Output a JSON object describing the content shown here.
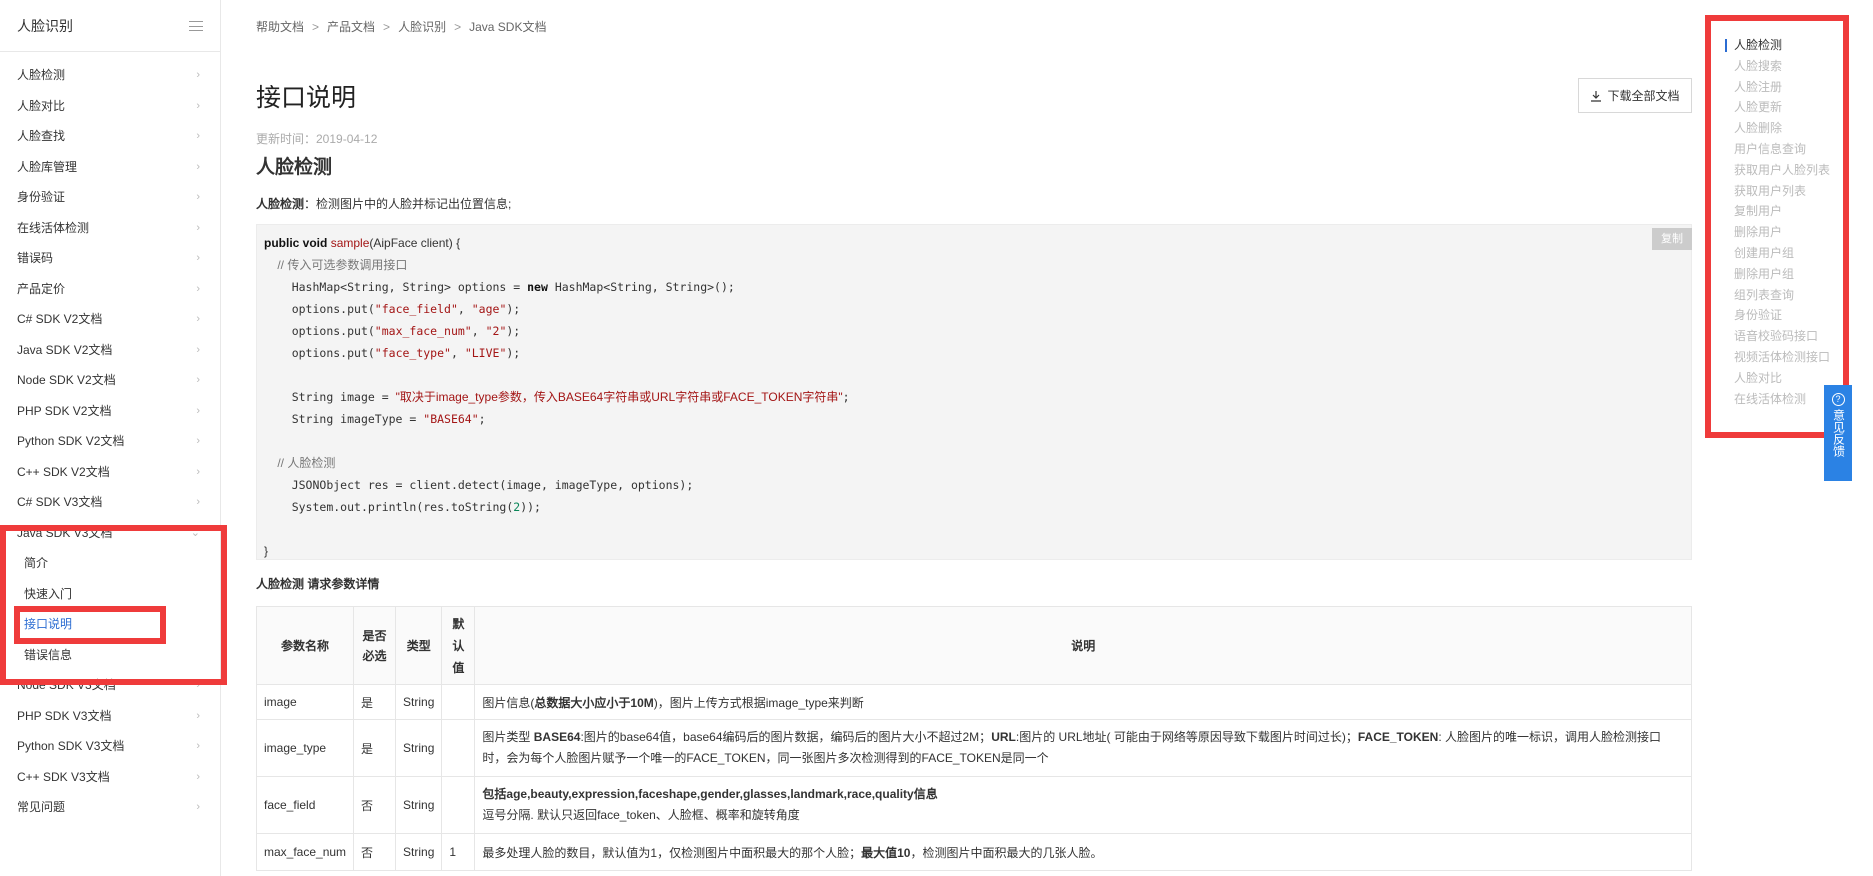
{
  "sidebar": {
    "title": "人脸识别",
    "items": [
      {
        "label": "人脸检测"
      },
      {
        "label": "人脸对比"
      },
      {
        "label": "人脸查找"
      },
      {
        "label": "人脸库管理"
      },
      {
        "label": "身份验证"
      },
      {
        "label": "在线活体检测"
      },
      {
        "label": "错误码"
      },
      {
        "label": "产品定价"
      },
      {
        "label": "C# SDK V2文档"
      },
      {
        "label": "Java SDK V2文档"
      },
      {
        "label": "Node SDK V2文档"
      },
      {
        "label": "PHP SDK V2文档"
      },
      {
        "label": "Python SDK V2文档"
      },
      {
        "label": "C++ SDK V2文档"
      },
      {
        "label": "C# SDK V3文档"
      },
      {
        "label": "Java SDK V3文档"
      }
    ],
    "sub_items": [
      {
        "label": "简介"
      },
      {
        "label": "快速入门"
      },
      {
        "label": "接口说明"
      },
      {
        "label": "错误信息"
      }
    ],
    "items_after": [
      {
        "label": "Node SDK V3文档"
      },
      {
        "label": "PHP SDK V3文档"
      },
      {
        "label": "Python SDK V3文档"
      },
      {
        "label": "C++ SDK V3文档"
      },
      {
        "label": "常见问题"
      }
    ]
  },
  "breadcrumb": [
    "帮助文档",
    "产品文档",
    "人脸识别",
    "Java SDK文档"
  ],
  "breadcrumb_sep": ">",
  "page_title": "接口说明",
  "download_label": "下载全部文档",
  "updated": "更新时间：2019-04-12",
  "section_heading": "人脸检测",
  "desc_bold": "人脸检测",
  "desc_text": "：检测图片中的人脸并标记出位置信息;",
  "copy_label": "复制",
  "code": {
    "l1_kw": "public void",
    "l1_fn": "sample",
    "l1_rest": "(AipFace client) {",
    "l2": "// 传入可选参数调用接口",
    "l3a": "HashMap<String, String> options = ",
    "l3kw": "new",
    "l3b": " HashMap<String, String>();",
    "l4a": "options.put(",
    "l4s1": "\"face_field\"",
    "l4m": ", ",
    "l4s2": "\"age\"",
    "l4e": ");",
    "l5a": "options.put(",
    "l5s1": "\"max_face_num\"",
    "l5m": ", ",
    "l5s2": "\"2\"",
    "l5e": ");",
    "l6a": "options.put(",
    "l6s1": "\"face_type\"",
    "l6m": ", ",
    "l6s2": "\"LIVE\"",
    "l6e": ");",
    "l8a": "String image = ",
    "l8s": "\"取决于image_type参数，传入BASE64字符串或URL字符串或FACE_TOKEN字符串\"",
    "l8e": ";",
    "l9a": "String imageType = ",
    "l9s": "\"BASE64\"",
    "l9e": ";",
    "l11": "// 人脸检测",
    "l12": "JSONObject res = client.detect(image, imageType, options);",
    "l13a": "System.out.println(res.toString(",
    "l13n": "2",
    "l13e": "));",
    "l15": "}"
  },
  "table_caption": "人脸检测 请求参数详情",
  "table": {
    "headers": [
      "参数名称",
      "是否必选",
      "类型",
      "默认值",
      "说明"
    ],
    "rows": [
      {
        "name": "image",
        "req": "是",
        "type": "String",
        "def": "",
        "desc_pre": "图片信息(",
        "desc_b1": "总数据大小应小于10M",
        "desc_post": ")，图片上传方式根据image_type来判断"
      },
      {
        "name": "image_type",
        "req": "是",
        "type": "String",
        "def": "",
        "desc_pre": "图片类型 ",
        "desc_b1": "BASE64",
        "desc_post": ":图片的base64值，base64编码后的图片数据，编码后的图片大小不超过2M；",
        "desc_b2": "URL",
        "desc_post2": ":图片的 URL地址( 可能由于网络等原因导致下载图片时间过长)；",
        "desc_b3": "FACE_TOKEN",
        "desc_post3": ": 人脸图片的唯一标识，调用人脸检测接口时，会为每个人脸图片赋予一个唯一的FACE_TOKEN，同一张图片多次检测得到的FACE_TOKEN是同一个"
      },
      {
        "name": "face_field",
        "req": "否",
        "type": "String",
        "def": "",
        "desc_b1": "包括age,beauty,expression,faceshape,gender,glasses,landmark,race,quality信息",
        "desc_post": "逗号分隔. 默认只返回face_token、人脸框、概率和旋转角度"
      },
      {
        "name": "max_face_num",
        "req": "否",
        "type": "String",
        "def": "1",
        "desc_pre": "最多处理人脸的数目，默认值为1，仅检测图片中面积最大的那个人脸；",
        "desc_b1": "最大值10",
        "desc_post": "，检测图片中面积最大的几张人脸。"
      }
    ]
  },
  "right_nav": [
    "人脸检测",
    "人脸搜索",
    "人脸注册",
    "人脸更新",
    "人脸删除",
    "用户信息查询",
    "获取用户人脸列表",
    "获取用户列表",
    "复制用户",
    "删除用户",
    "创建用户组",
    "删除用户组",
    "组列表查询",
    "身份验证",
    "语音校验码接口",
    "视频活体检测接口",
    "人脸对比",
    "在线活体检测"
  ],
  "feedback_label": "意见反馈",
  "colors": {
    "accent": "#2b6cd2",
    "highlight_box": "#ef3b3b",
    "feedback_bg": "#2b82e4"
  }
}
